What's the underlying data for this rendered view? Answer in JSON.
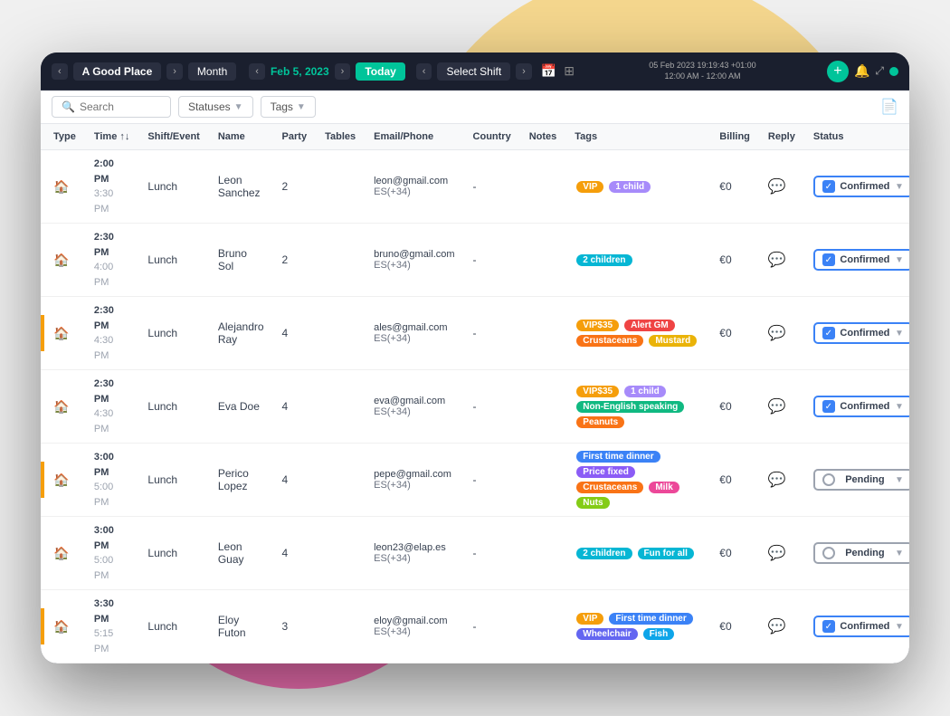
{
  "scene": {
    "topbar": {
      "venue_prev": "‹",
      "venue_name": "A Good Place",
      "venue_next": "›",
      "view_mode": "Month",
      "date_prev": "‹",
      "date": "Feb 5, 2023",
      "date_next": "›",
      "today_label": "Today",
      "shift_prev": "‹",
      "shift_label": "Select Shift",
      "shift_next": "›",
      "datetime_line1": "05 Feb 2023 19:19:43 +01:00",
      "datetime_line2": "12:00 AM - 12:00 AM",
      "add_icon": "+",
      "bell_icon": "🔔",
      "expand_icon": "⤢",
      "status_color": "#00c49a"
    },
    "filterbar": {
      "search_placeholder": "Search",
      "statuses_label": "Statuses",
      "tags_label": "Tags",
      "export_icon": "📄"
    },
    "table": {
      "columns": [
        "Type",
        "Time ↑↓",
        "Shift/Event",
        "Name",
        "Party",
        "Tables",
        "Email/Phone",
        "Country",
        "Notes",
        "Tags",
        "Billing",
        "Reply",
        "Status"
      ],
      "rows": [
        {
          "indicator": "none",
          "type_icon": "🏠",
          "time_start": "2:00 PM",
          "time_end": "3:30 PM",
          "shift": "Lunch",
          "name": "Leon Sanchez",
          "party": "2",
          "tables": "",
          "email": "leon@gmail.com",
          "phone": "ES(+34)",
          "country": "-",
          "notes": "",
          "tags": [
            {
              "label": "VIP",
              "class": "tag-vip"
            },
            {
              "label": "1 child",
              "class": "tag-child"
            }
          ],
          "billing": "€0",
          "status": "Confirmed",
          "status_type": "confirmed"
        },
        {
          "indicator": "none",
          "type_icon": "🏠",
          "time_start": "2:30 PM",
          "time_end": "4:00 PM",
          "shift": "Lunch",
          "name": "Bruno Sol",
          "party": "2",
          "tables": "",
          "email": "bruno@gmail.com",
          "phone": "ES(+34)",
          "country": "-",
          "notes": "",
          "tags": [
            {
              "label": "2 children",
              "class": "tag-2children"
            }
          ],
          "billing": "€0",
          "status": "Confirmed",
          "status_type": "confirmed"
        },
        {
          "indicator": "yellow",
          "type_icon": "🏠",
          "time_start": "2:30 PM",
          "time_end": "4:30 PM",
          "shift": "Lunch",
          "name": "Alejandro Ray",
          "party": "4",
          "tables": "",
          "email": "ales@gmail.com",
          "phone": "ES(+34)",
          "country": "-",
          "notes": "",
          "tags": [
            {
              "label": "VIP$35",
              "class": "tag-vip33"
            },
            {
              "label": "Alert GM",
              "class": "tag-alert"
            },
            {
              "label": "Crustaceans",
              "class": "tag-crustaceans"
            },
            {
              "label": "Mustard",
              "class": "tag-mustard"
            }
          ],
          "billing": "€0",
          "status": "Confirmed",
          "status_type": "confirmed"
        },
        {
          "indicator": "none",
          "type_icon": "🏠",
          "time_start": "2:30 PM",
          "time_end": "4:30 PM",
          "shift": "Lunch",
          "name": "Eva Doe",
          "party": "4",
          "tables": "",
          "email": "eva@gmail.com",
          "phone": "ES(+34)",
          "country": "-",
          "notes": "",
          "tags": [
            {
              "label": "VIP$35",
              "class": "tag-vip33"
            },
            {
              "label": "1 child",
              "class": "tag-child"
            },
            {
              "label": "Non-English speaking",
              "class": "tag-non-english"
            },
            {
              "label": "Peanuts",
              "class": "tag-peanuts"
            }
          ],
          "billing": "€0",
          "status": "Confirmed",
          "status_type": "confirmed"
        },
        {
          "indicator": "yellow",
          "type_icon": "🏠",
          "time_start": "3:00 PM",
          "time_end": "5:00 PM",
          "shift": "Lunch",
          "name": "Perico Lopez",
          "party": "4",
          "tables": "",
          "email": "pepe@gmail.com",
          "phone": "ES(+34)",
          "country": "-",
          "notes": "",
          "tags": [
            {
              "label": "First time dinner",
              "class": "tag-first-time"
            },
            {
              "label": "Price fixed",
              "class": "tag-price-fixed"
            },
            {
              "label": "Crustaceans",
              "class": "tag-crustaceans"
            },
            {
              "label": "Milk",
              "class": "tag-milk"
            },
            {
              "label": "Nuts",
              "class": "tag-nuts"
            }
          ],
          "billing": "€0",
          "status": "Pending",
          "status_type": "pending"
        },
        {
          "indicator": "none",
          "type_icon": "🏠",
          "time_start": "3:00 PM",
          "time_end": "5:00 PM",
          "shift": "Lunch",
          "name": "Leon Guay",
          "party": "4",
          "tables": "",
          "email": "leon23@elap.es",
          "phone": "ES(+34)",
          "country": "-",
          "notes": "",
          "tags": [
            {
              "label": "2 children",
              "class": "tag-2children"
            },
            {
              "label": "Fun for all",
              "class": "tag-fun"
            }
          ],
          "billing": "€0",
          "status": "Pending",
          "status_type": "pending"
        },
        {
          "indicator": "yellow",
          "type_icon": "🏠",
          "time_start": "3:30 PM",
          "time_end": "5:15 PM",
          "shift": "Lunch",
          "name": "Eloy Futon",
          "party": "3",
          "tables": "",
          "email": "eloy@gmail.com",
          "phone": "ES(+34)",
          "country": "-",
          "notes": "",
          "tags": [
            {
              "label": "VIP",
              "class": "tag-vip"
            },
            {
              "label": "First time dinner",
              "class": "tag-first-time"
            },
            {
              "label": "Wheelchair",
              "class": "tag-wheelchair"
            },
            {
              "label": "Fish",
              "class": "tag-fish"
            }
          ],
          "billing": "€0",
          "status": "Confirmed",
          "status_type": "confirmed"
        }
      ]
    }
  }
}
